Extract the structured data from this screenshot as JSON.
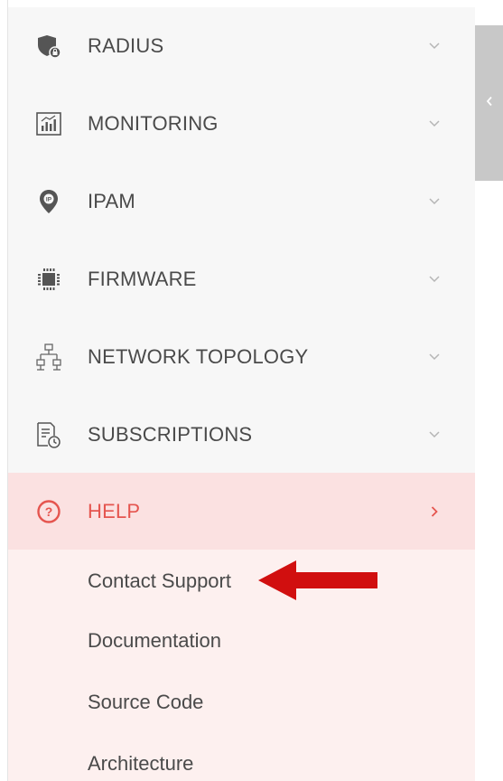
{
  "menu": {
    "items": [
      {
        "label": "RADIUS",
        "icon": "shield-lock-icon"
      },
      {
        "label": "MONITORING",
        "icon": "bar-chart-icon"
      },
      {
        "label": "IPAM",
        "icon": "ip-pin-icon"
      },
      {
        "label": "FIRMWARE",
        "icon": "chip-icon"
      },
      {
        "label": "NETWORK TOPOLOGY",
        "icon": "topology-icon"
      },
      {
        "label": "SUBSCRIPTIONS",
        "icon": "subscription-clock-icon"
      },
      {
        "label": "HELP",
        "icon": "help-circle-icon",
        "active": true
      }
    ]
  },
  "help_submenu": {
    "items": [
      {
        "label": "Contact Support"
      },
      {
        "label": "Documentation"
      },
      {
        "label": "Source Code"
      },
      {
        "label": "Architecture"
      }
    ]
  },
  "colors": {
    "accent": "#e5554f",
    "active_bg": "#fbe1e1",
    "submenu_bg": "#fdf0ef",
    "sidebar_bg": "#f7f7f7",
    "annotation_arrow": "#d10f0f"
  }
}
